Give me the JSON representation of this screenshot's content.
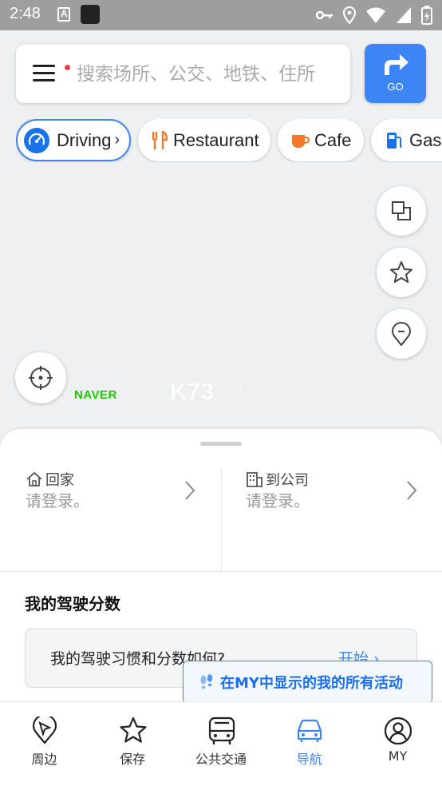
{
  "status_bar": {
    "time": "2:48",
    "notification_icons": [
      "a-icon",
      "app-icon"
    ],
    "system_icons": [
      "key-icon",
      "location-icon",
      "wifi-icon",
      "signal-icon",
      "battery-icon"
    ]
  },
  "search": {
    "placeholder": "搜索场所、公交、地铁、住所",
    "go_label": "GO"
  },
  "chips": [
    {
      "label": "Driving",
      "icon": "speedometer-icon"
    },
    {
      "label": "Restaurant",
      "icon": "fork-knife-icon"
    },
    {
      "label": "Cafe",
      "icon": "coffee-cup-icon"
    },
    {
      "label": "Gas",
      "icon": "gas-pump-icon"
    }
  ],
  "map": {
    "brand": "NAVER",
    "watermark_main": "K73",
    "watermark_sub": "游戏之家",
    "watermark_domain": ".com"
  },
  "quick_access": {
    "home": {
      "title": "回家",
      "subtitle": "请登录。"
    },
    "work": {
      "title": "到公司",
      "subtitle": "请登录。"
    }
  },
  "driving_score": {
    "title": "我的驾驶分数",
    "question": "我的驾驶习惯和分数如何?",
    "start_label": "开始"
  },
  "tooltip": {
    "text": "在MY中显示的我的所有活动"
  },
  "bottom_nav": [
    {
      "label": "周边",
      "active": false
    },
    {
      "label": "保存",
      "active": false
    },
    {
      "label": "公共交通",
      "active": false
    },
    {
      "label": "导航",
      "active": true
    },
    {
      "label": "MY",
      "active": false
    }
  ],
  "colors": {
    "accent": "#3d85f5",
    "naver_green": "#1ec800",
    "status_bar": "#9e9e9e"
  }
}
